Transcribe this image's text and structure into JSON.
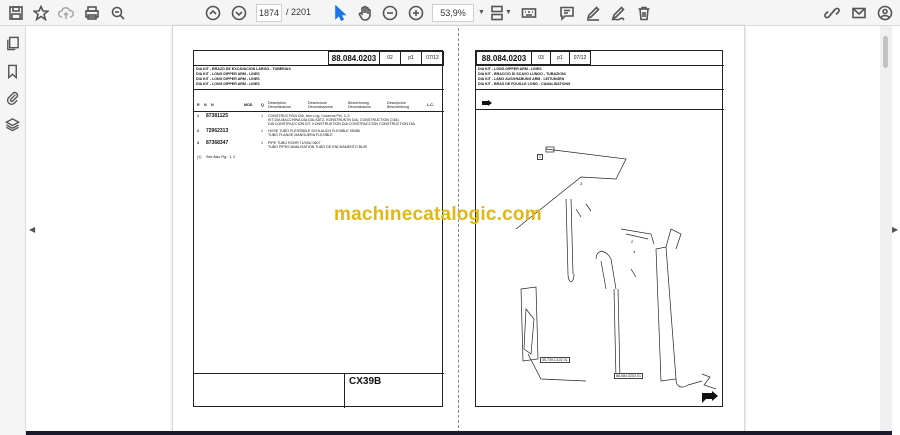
{
  "toolbar": {
    "page_current": "1874",
    "page_total": "/  2201",
    "zoom": "53,9%"
  },
  "left_sheet": {
    "code": "88.084.0203",
    "sheet_no": "02",
    "page": "p1",
    "date": "07/12",
    "titles": [
      "DIA KIT - BRAZO DE EXCAVACION LARGO - TUBERIAS",
      "DIA KIT - LONG DIPPER ARM - LINES",
      "DIA KIT - LONG DIPPER ARM - LINES",
      "DIA KIT - LONG DIPPER ARM - LINES"
    ],
    "columns": [
      "R",
      "N",
      "N",
      "MOD",
      "Q",
      "Description\nDenominacion",
      "Descrizione\nDenominazione",
      "Bezeichnung\nDenominación",
      "Descripción\nBeschreibung",
      "L.C."
    ],
    "rows": [
      {
        "ref": "1",
        "part": "87381125",
        "q": "1",
        "desc": [
          "CONSTRUCTION DIA, Arm Lng, Conexns Pnl, C-3",
          "KIT DIA MACCHINA DIA    DIA-SATZ, KONSTRUKTN    DIA, CONSTRUCTION    CG61",
          "DIA CONSTRUCCION    KIT, KONSTRUKTION    DIA CONSTRUCCION    CONSTRUCTION DIA"
        ]
      },
      {
        "ref": "2",
        "part": "72962313",
        "q": "1",
        "desc": [
          "HOSE    TUBO FLESSIBILE    SCHLAUCH    FLEXIBLE    05086",
          "TUBO    FLANGE    MANGUERA    FLEXIBLE"
        ]
      },
      {
        "ref": "3",
        "part": "87368347",
        "q": "1",
        "desc": [
          "PIPE    TUBO    ROHR    TUYAU    0607",
          "TUBO    PIPE/CANALISATION    TUBO DE ENCHAMENTO    BUIS"
        ]
      }
    ],
    "footnote": "See Also Fig.: 1, 2",
    "note_ref": "(1)",
    "model": "CX39B"
  },
  "right_sheet": {
    "code": "88.084.0203",
    "sheet_no": "03",
    "page": "p1",
    "date": "07/12",
    "titles": [
      "DIA KIT - LONG DIPPER ARM - LINES",
      "DIA KIT - BRACCIO DI SCAVO LUNGO - TUBAZIONI",
      "DIA KIT - LANG AUSGRABUNG ARM - LEITUNGEN",
      "DIA KIT - BRAS DE FOUILLE LONG - CANALISATIONS"
    ],
    "callouts": {
      "part_1": "1",
      "part_2": "2",
      "part_3": "3",
      "part_4": "4",
      "ref_a": "35.739.C102 01",
      "ref_b": "88.084.0203 01"
    }
  },
  "watermark": "machinecatalogic.com"
}
